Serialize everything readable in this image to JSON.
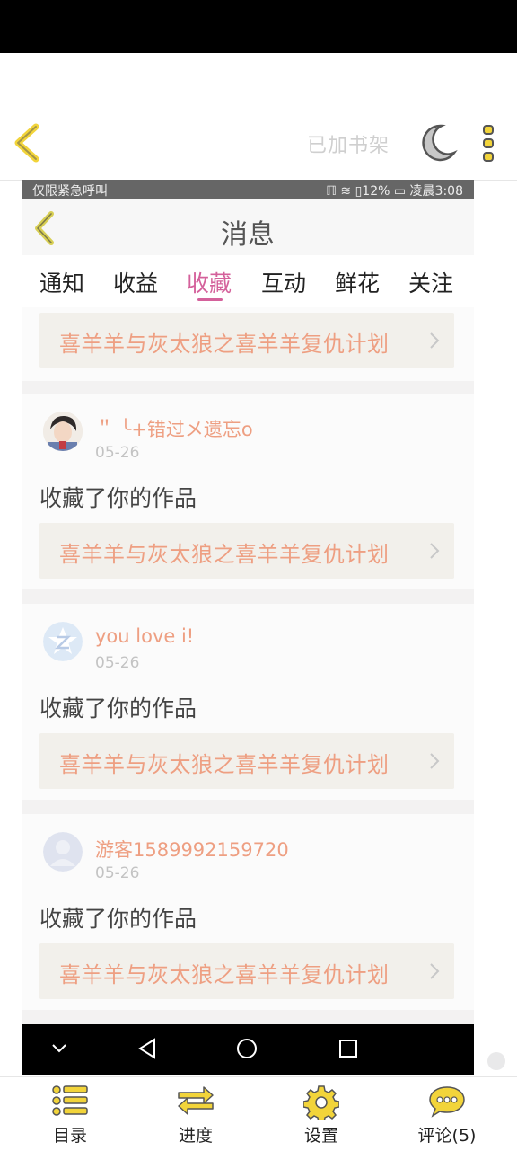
{
  "reader": {
    "shelf_label": "已加书架"
  },
  "status_bar": {
    "left": "仅限紧急呼叫",
    "right": "ℿ ≋ ▯12% ▭ 凌晨3:08"
  },
  "page": {
    "title": "消息",
    "tabs": [
      {
        "label": "通知",
        "active": false
      },
      {
        "label": "收益",
        "active": false
      },
      {
        "label": "收藏",
        "active": true
      },
      {
        "label": "互动",
        "active": false
      },
      {
        "label": "鲜花",
        "active": false
      },
      {
        "label": "关注",
        "active": false
      }
    ]
  },
  "work_title": "喜羊羊与灰太狼之喜羊羊复仇计划",
  "messages": [
    {
      "user": "＂ ╰+错过メ遗忘o",
      "date": "05-26",
      "action": "收藏了你的作品",
      "work": "喜羊羊与灰太狼之喜羊羊复仇计划"
    },
    {
      "user": "you love i!",
      "date": "05-26",
      "action": "收藏了你的作品",
      "work": "喜羊羊与灰太狼之喜羊羊复仇计划"
    },
    {
      "user": "游客1589992159720",
      "date": "05-26",
      "action": "收藏了你的作品",
      "work": "喜羊羊与灰太狼之喜羊羊复仇计划"
    }
  ],
  "bottom_bar": {
    "items": [
      {
        "label": "目录",
        "icon": "list-icon"
      },
      {
        "label": "进度",
        "icon": "progress-arrows-icon"
      },
      {
        "label": "设置",
        "icon": "gear-icon"
      },
      {
        "label": "评论(5)",
        "icon": "comment-bubble-icon"
      }
    ]
  },
  "colors": {
    "accent_yellow": "#f2d43a",
    "active_tab": "#d4619b",
    "work_title": "#ee9f82"
  }
}
